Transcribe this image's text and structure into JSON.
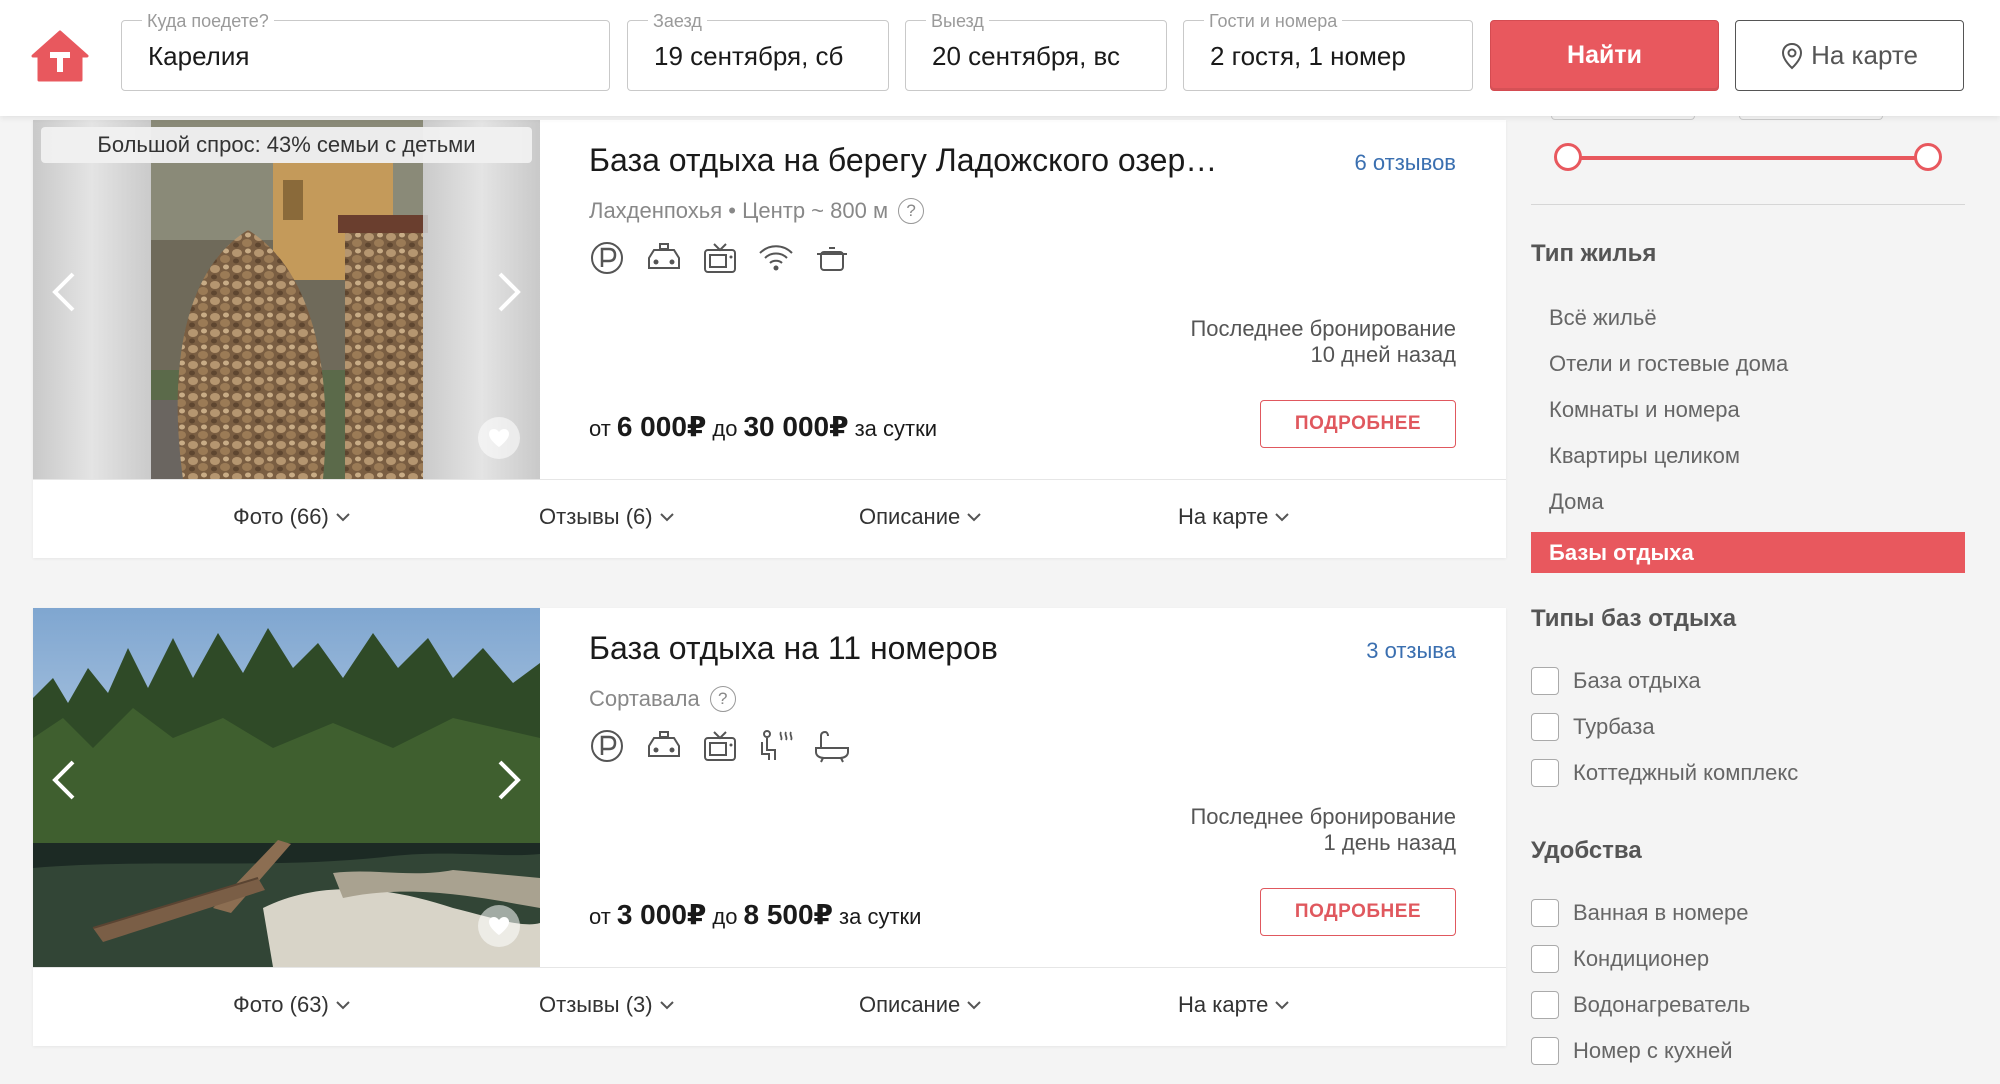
{
  "search": {
    "destination": {
      "label": "Куда поедете?",
      "value": "Карелия"
    },
    "checkin": {
      "label": "Заезд",
      "value": "19 сентября, сб"
    },
    "checkout": {
      "label": "Выезд",
      "value": "20 сентября, вс"
    },
    "guests": {
      "label": "Гости и номера",
      "value": "2 гостя, 1 номер"
    },
    "find_label": "Найти",
    "map_label": "На карте"
  },
  "colors": {
    "accent": "#e8585e",
    "link": "#3a6fb0"
  },
  "listings": [
    {
      "badge": "Большой спрос: 43% семьи с детьми",
      "title": "База отдыха на берегу Ладожского озер…",
      "reviews_link": "6 отзывов",
      "location": "Лахденпохья • Центр ~ 800 м",
      "amenities": [
        "parking-icon",
        "car-icon",
        "tv-icon",
        "wifi-icon",
        "pot-icon"
      ],
      "last_booking_label": "Последнее бронирование",
      "last_booking_when": "10 дней назад",
      "price_from_word": "от",
      "price_from": "6 000₽",
      "price_to_word": "до",
      "price_to": "30 000₽",
      "price_suffix": "за сутки",
      "more_label": "ПОДРОБНЕЕ",
      "tabs": [
        "Фото (66)",
        "Отзывы (6)",
        "Описание",
        "На карте"
      ]
    },
    {
      "badge": "",
      "title": "База отдыха на 11 номеров",
      "reviews_link": "3 отзыва",
      "location": "Сортавала",
      "amenities": [
        "parking-icon",
        "car-icon",
        "tv-icon",
        "sauna-icon",
        "bathtub-icon"
      ],
      "last_booking_label": "Последнее бронирование",
      "last_booking_when": "1 день назад",
      "price_from_word": "от",
      "price_from": "3 000₽",
      "price_to_word": "до",
      "price_to": "8 500₽",
      "price_suffix": "за сутки",
      "more_label": "ПОДРОБНЕЕ",
      "tabs": [
        "Фото (63)",
        "Отзывы (3)",
        "Описание",
        "На карте"
      ]
    }
  ],
  "sidebar": {
    "housing_type": {
      "heading": "Тип жилья",
      "items": [
        "Всё жильё",
        "Отели и гостевые дома",
        "Комнаты и номера",
        "Квартиры целиком",
        "Дома"
      ],
      "active": "Базы отдыха"
    },
    "resort_types": {
      "heading": "Типы баз отдыха",
      "items": [
        "База отдыха",
        "Турбаза",
        "Коттеджный комплекс"
      ]
    },
    "amenities": {
      "heading": "Удобства",
      "items": [
        "Ванная в номере",
        "Кондиционер",
        "Водонагреватель",
        "Номер с кухней"
      ]
    }
  }
}
